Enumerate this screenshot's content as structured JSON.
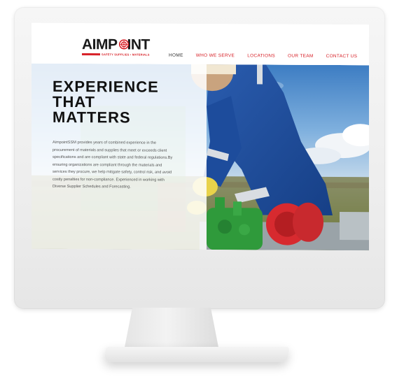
{
  "brand": {
    "logo_word_part1": "AIMP",
    "logo_word_part2": "INT",
    "tagline": "SAFETY SUPPLIES • MATERIALS"
  },
  "nav": {
    "items": [
      {
        "label": "HOME",
        "active": true
      },
      {
        "label": "WHO WE SERVE",
        "active": false
      },
      {
        "label": "LOCATIONS",
        "active": false
      },
      {
        "label": "OUR TEAM",
        "active": false
      },
      {
        "label": "CONTACT US",
        "active": false
      }
    ]
  },
  "hero": {
    "title_line1": "EXPERIENCE",
    "title_line2": "THAT",
    "title_line3": "MATTERS",
    "body": "AimpointSSM provides years of combined experience in the procurement of materials and supplies that meet or exceeds client specifications and are compliant with state and federal regulations.By ensuring organizations are compliant through the materials and services they procure, we help mitigate safety, control risk, and avoid costly penalties for non-compliance. Experienced in working with Diverse Supplier Schedules and Forecasting.",
    "photo_icon": "industrial-worker-photo"
  },
  "colors": {
    "brand_red": "#d71f26",
    "text_dark": "#111111",
    "coverall_blue": "#1f4e9c",
    "valve_green": "#2f9a3b",
    "sky_blue": "#6e9fd0"
  }
}
